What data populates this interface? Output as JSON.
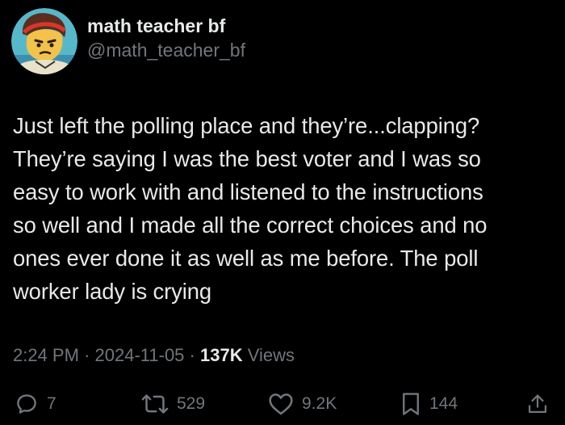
{
  "author": {
    "display_name": "math teacher bf",
    "handle": "@math_teacher_bf",
    "avatar_icon": "cartoon-character-avatar-icon"
  },
  "tweet": {
    "text": "Just left the polling place and they’re...clapping?\nThey’re saying I was the best voter and I was so\neasy to work with and listened to the instructions\nso well and I made all the correct choices and no\nones ever done it as well as me before. The poll\nworker lady is crying"
  },
  "meta": {
    "time": "2:24 PM",
    "separator": "·",
    "date": "2024-11-05",
    "views_count": "137K",
    "views_label": "Views"
  },
  "actions": {
    "reply": {
      "icon": "reply-icon",
      "count": "7"
    },
    "retweet": {
      "icon": "retweet-icon",
      "count": "529"
    },
    "like": {
      "icon": "heart-icon",
      "count": "9.2K"
    },
    "bookmark": {
      "icon": "bookmark-icon",
      "count": "144"
    },
    "share": {
      "icon": "share-icon"
    }
  },
  "colors": {
    "background": "#000000",
    "primary_text": "#e7e9ea",
    "secondary_text": "#71767b"
  }
}
